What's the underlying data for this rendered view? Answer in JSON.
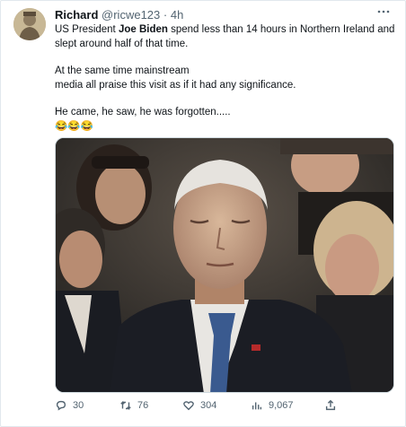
{
  "tweet": {
    "author": {
      "name": "Richard",
      "handle": "@ricwe123",
      "time": "4h"
    },
    "more_icon": "more-horizontal-icon",
    "text": {
      "line1_prefix": "US President ",
      "line1_bold": "Joe Biden",
      "line1_suffix": " spend less than 14 hours in Northern Ireland and",
      "line2": "slept around half of that time.",
      "line3": "At the same time mainstream",
      "line4": "media all praise this visit as if it had any significance.",
      "line5": "He came, he saw, he was forgotten.....",
      "line6": "😂😂😂"
    },
    "media": {
      "alt": "Man in a dark suit with eyes closed seated in an audience",
      "icon": "photo"
    },
    "actions": {
      "replies": "30",
      "retweets": "76",
      "likes": "304",
      "views": "9,067"
    }
  }
}
